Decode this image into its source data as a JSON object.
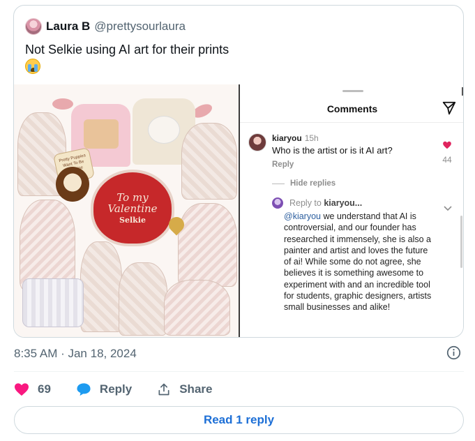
{
  "tweet": {
    "author": {
      "display_name": "Laura B",
      "handle": "@prettysourlaura"
    },
    "text": "Not Selkie using AI art for their prints",
    "emoji": "loudly-crying-face"
  },
  "media": {
    "collage": {
      "sign_text": "Pretty Puppies Want To Be Valentine",
      "heart_text": "To my Valentine",
      "brand": "Selkie"
    },
    "comments_panel": {
      "title": "Comments",
      "comment": {
        "user": "kiaryou",
        "time": "15h",
        "text": "Who is the artist or is it AI art?",
        "reply_label": "Reply",
        "likes": "44"
      },
      "hide_replies_label": "Hide replies",
      "reply": {
        "reply_to_label": "Reply to",
        "reply_to_user": "kiaryou...",
        "mention": "@kiaryou",
        "text": " we understand that AI is controversial, and our founder has researched it immensely, she is also a painter and artist and loves the future of ai! While some do not agree, she believes it is something awesome to experiment with and an incredible tool for students, graphic designers, artists small businesses and alike!"
      }
    }
  },
  "meta": {
    "timestamp": "8:35 AM · Jan 18, 2024"
  },
  "actions": {
    "likes": "69",
    "reply_label": "Reply",
    "share_label": "Share"
  },
  "read_reply_label": "Read 1 reply",
  "colors": {
    "like": "#f91880",
    "reply_bubble": "#1d9bf0",
    "link": "#1d6fd6",
    "heart_card": "#c6282a"
  }
}
